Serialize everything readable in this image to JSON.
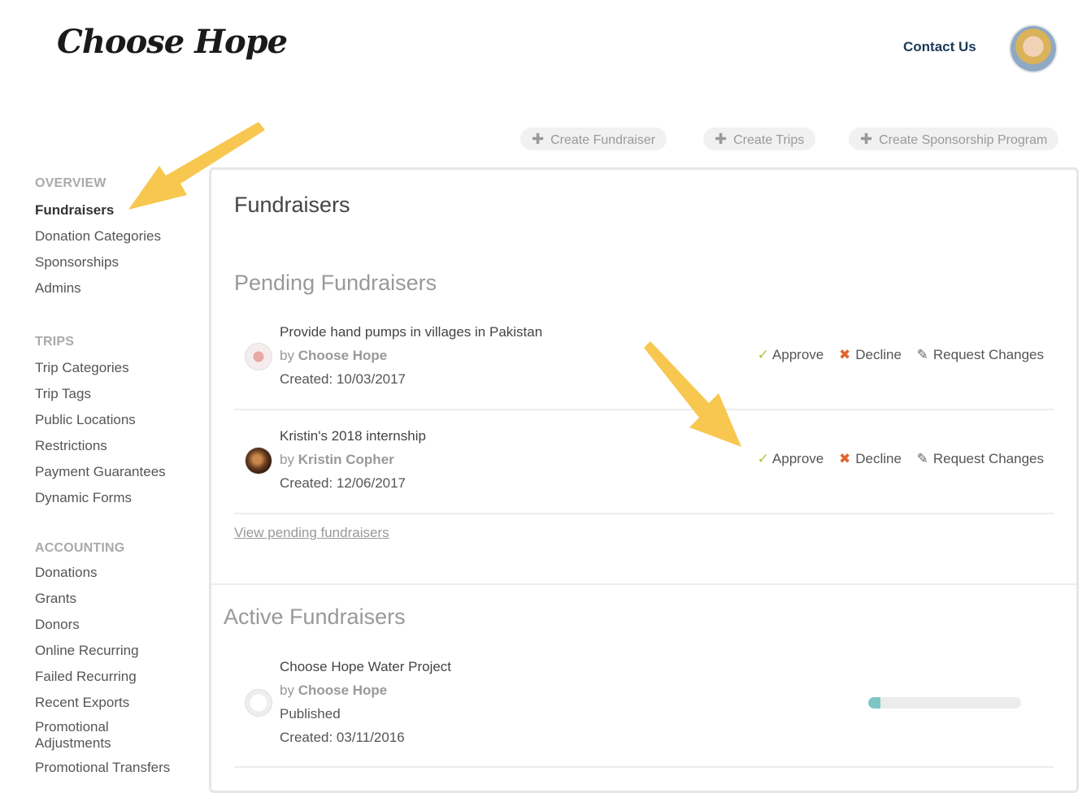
{
  "header": {
    "logo": "Choose Hope",
    "contact_label": "Contact Us"
  },
  "top_actions": [
    {
      "label": "Create Fundraiser",
      "icon": "plus-icon"
    },
    {
      "label": "Create Trips",
      "icon": "plus-icon"
    },
    {
      "label": "Create Sponsorship Program",
      "icon": "plus-icon"
    }
  ],
  "sidebar": {
    "overview": {
      "heading": "OVERVIEW",
      "items": [
        "Fundraisers",
        "Donation Categories",
        "Sponsorships",
        "Admins"
      ]
    },
    "trips": {
      "heading": "TRIPS",
      "items": [
        "Trip Categories",
        "Trip Tags",
        "Public Locations",
        "Restrictions",
        "Payment Guarantees",
        "Dynamic Forms"
      ]
    },
    "accounting": {
      "heading": "ACCOUNTING",
      "items": [
        "Donations",
        "Grants",
        "Donors",
        "Online Recurring",
        "Failed Recurring",
        "Recent Exports",
        "Promotional Adjustments",
        "Promotional Transfers"
      ]
    }
  },
  "main": {
    "title": "Fundraisers",
    "pending": {
      "title": "Pending Fundraisers",
      "rows": [
        {
          "title": "Provide hand pumps in villages in Pakistan",
          "by": "by",
          "owner": "Choose Hope",
          "created": "Created: 10/03/2017"
        },
        {
          "title": "Kristin's 2018 internship",
          "by": "by",
          "owner": "Kristin Copher",
          "created": "Created: 12/06/2017"
        }
      ],
      "actions": {
        "approve": "Approve",
        "decline": "Decline",
        "request": "Request Changes"
      },
      "view_link": "View pending fundraisers"
    },
    "active": {
      "title": "Active Fundraisers",
      "rows": [
        {
          "title": "Choose Hope Water Project",
          "by": "by",
          "owner": "Choose Hope",
          "status": "Published",
          "created": "Created: 03/11/2016",
          "progress": 0.08
        }
      ]
    }
  },
  "colors": {
    "accent_navy": "#1b3a57",
    "approve_green": "#a8c543",
    "decline_orange": "#e0652a",
    "arrow_yellow": "#f7c750",
    "progress_teal": "#7ec6c6"
  }
}
